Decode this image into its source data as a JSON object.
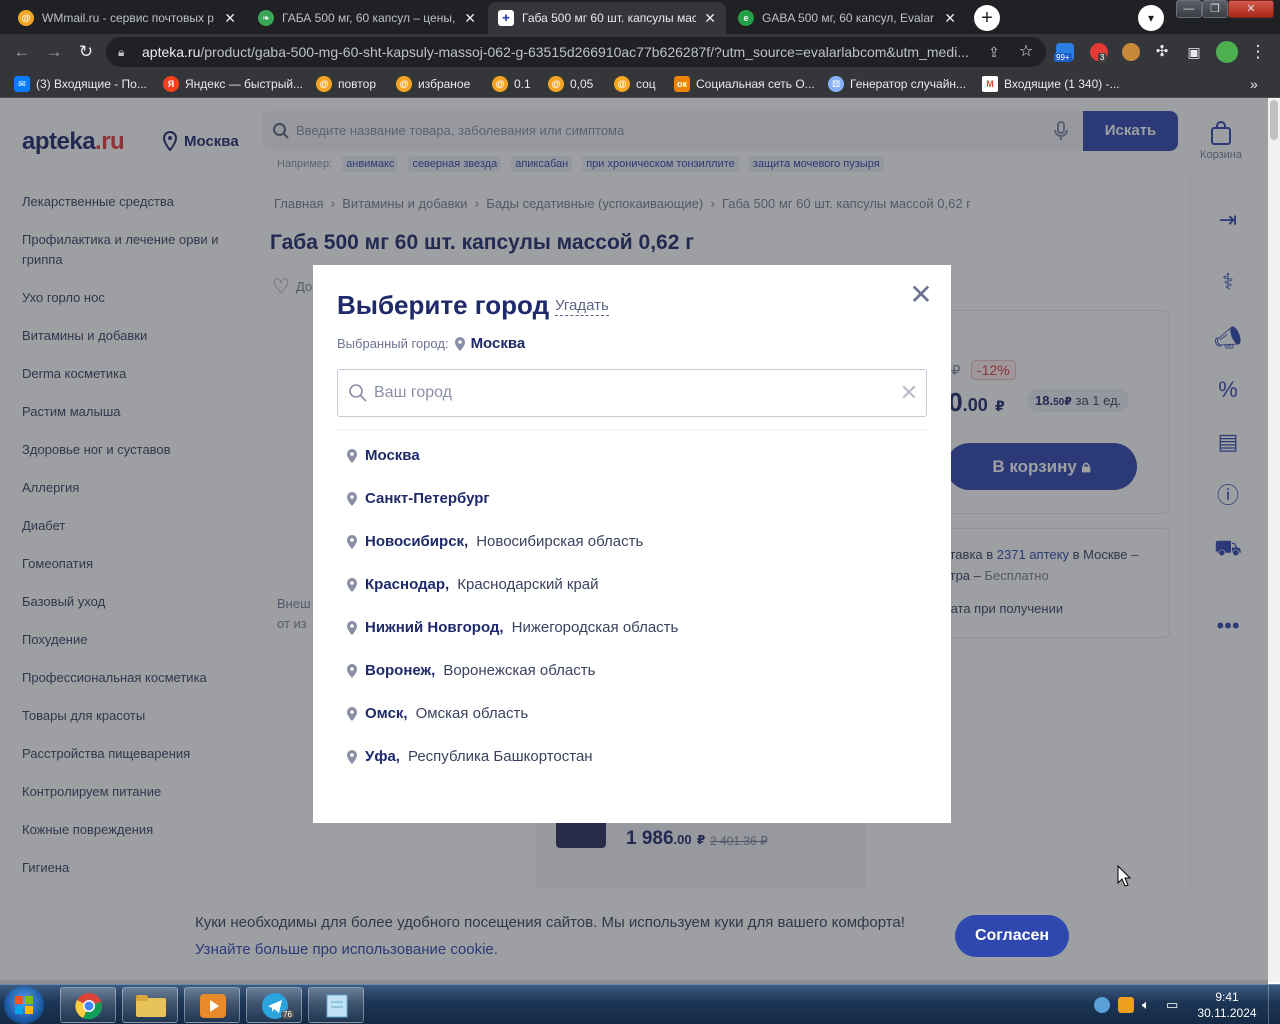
{
  "browser": {
    "tabs": [
      {
        "title": "WMmail.ru - сервис почтовых р",
        "favicon": "wmmail-icon",
        "color": "#f5a623",
        "active": false
      },
      {
        "title": "ГАБА 500 мг, 60 капсул – цены, о",
        "favicon": "leaf-icon",
        "color": "#3aa757",
        "active": false
      },
      {
        "title": "Габа 500 мг 60 шт. капсулы масс",
        "favicon": "apteka-cross-icon",
        "color": "#2e48b0",
        "active": true
      },
      {
        "title": "GABA 500 мг, 60 капсул, Evalar L",
        "favicon": "evalar-leaf-icon",
        "color": "#24a148",
        "active": false
      }
    ],
    "url_host": "apteka.ru",
    "url_path": "/product/gaba-500-mg-60-sht-kapsuly-massoj-062-g-63515d266910ac77b626287f/?utm_source=evalarlabcom&utm_medi...",
    "ext_badge_1": "99+",
    "ext_badge_2": "3",
    "bookmarks": [
      {
        "label": "(3) Входящие - По...",
        "icon": "mail-icon",
        "color": "#0a7cff"
      },
      {
        "label": "Яндекс — быстрый...",
        "icon": "yandex-icon",
        "color": "#fc3f1d",
        "letter": "Я"
      },
      {
        "label": "повтор",
        "icon": "wmmail-icon",
        "color": "#f5a623"
      },
      {
        "label": "избраное",
        "icon": "wmmail-icon",
        "color": "#f5a623"
      },
      {
        "label": "0.1",
        "icon": "wmmail-icon",
        "color": "#f5a623"
      },
      {
        "label": "0,05",
        "icon": "wmmail-icon",
        "color": "#f5a623"
      },
      {
        "label": "соц",
        "icon": "wmmail-icon",
        "color": "#f5a623"
      },
      {
        "label": "Социальная сеть О...",
        "icon": "odnoklassniki-icon",
        "color": "#ee8208"
      },
      {
        "label": "Генератор случайн...",
        "icon": "dice-icon",
        "color": "#8ab4f8"
      },
      {
        "label": "Входящие (1 340) -...",
        "icon": "gmail-icon",
        "color": "#ea4335",
        "letter": "M"
      }
    ]
  },
  "site": {
    "logo_main": "apteka",
    "logo_tld": ".ru",
    "city": "Москва",
    "search_placeholder": "Введите название товара, заболевания или симптома",
    "search_button": "Искать",
    "cart_label": "Корзина",
    "examples_label": "Например:",
    "examples": [
      "анвимакс",
      "северная звезда",
      "апиксабан",
      "при хроническом тонзиллите",
      "защита мочевого пузыря"
    ],
    "sidebar": [
      "Лекарственные средства",
      "Профилактика и лечение орви и гриппа",
      "Ухо горло нос",
      "Витамины и добавки",
      "Derma косметика",
      "Растим малыша",
      "Здоровье ног и суставов",
      "Аллергия",
      "Диабет",
      "Гомеопатия",
      "Базовый уход",
      "Похудение",
      "Профессиональная косметика",
      "Товары для красоты",
      "Расстройства пищеварения",
      "Контролируем питание",
      "Кожные повреждения",
      "Гигиена"
    ],
    "breadcrumbs": [
      "Главная",
      "Витамины и добавки",
      "Бады седативные (успокаивающие)",
      "Габа 500 мг 60 шт. капсулы массой 0,62 г"
    ],
    "product_title": "Габа 500 мг 60 шт. капсулы массой 0,62 г",
    "fav_partial": "До",
    "old_price_partial": "5 ₽",
    "discount": "-12%",
    "price_partial": ".0",
    "price_kop": ".00",
    "price_cur": "₽",
    "unit_price": "18.",
    "unit_price_kop": "50",
    "unit_price_cur": "₽",
    "unit_label": "за 1 ед.",
    "to_cart": "В корзину",
    "delivery_prefix": "ставка в",
    "delivery_link": "2371 аптеку",
    "delivery_suffix": "в Москве –",
    "delivery_line2_a": "втра –",
    "delivery_line2_b": "Бесплатно",
    "payment": "лата при получении",
    "left_partial_1": "Внеш",
    "left_partial_2": "от из",
    "bottom_price": "1 986",
    "bottom_price_kop": ".00",
    "bottom_price_cur": "₽",
    "bottom_old_price": "2 401.36 ₽",
    "cookie_text": "Куки необходимы для более удобного посещения сайтов. Мы используем куки для вашего комфорта!",
    "cookie_link": "Узнайте больше про использование cookie.",
    "cookie_button": "Согласен"
  },
  "modal": {
    "title": "Выберите город",
    "guess_link": "Угадать",
    "selected_label": "Выбранный город:",
    "selected_city": "Москва",
    "input_placeholder": "Ваш город",
    "input_value": "",
    "cities": [
      {
        "name": "Москва",
        "region": ""
      },
      {
        "name": "Санкт-Петербург",
        "region": ""
      },
      {
        "name": "Новосибирск,",
        "region": "Новосибирская область"
      },
      {
        "name": "Краснодар,",
        "region": "Краснодарский край"
      },
      {
        "name": "Нижний Новгород,",
        "region": "Нижегородская область"
      },
      {
        "name": "Воронеж,",
        "region": "Воронежская область"
      },
      {
        "name": "Омск,",
        "region": "Омская область"
      },
      {
        "name": "Уфа,",
        "region": "Республика Башкортостан"
      }
    ]
  },
  "taskbar": {
    "time": "9:41",
    "date": "30.11.2024",
    "telegram_badge": "76"
  }
}
